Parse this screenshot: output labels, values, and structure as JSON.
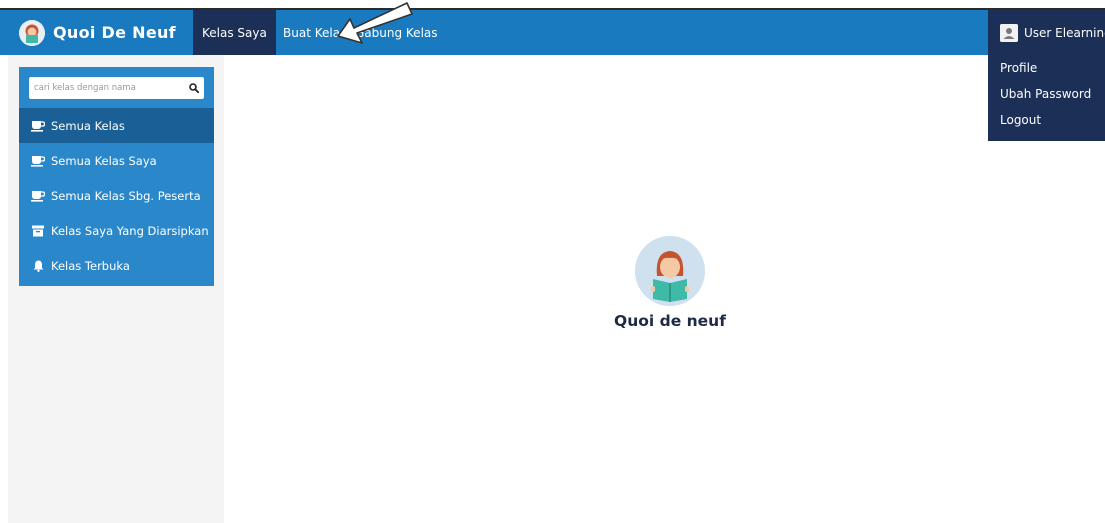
{
  "brand": {
    "name": "Quoi De Neuf"
  },
  "navbar": {
    "items": [
      {
        "label": "Kelas Saya",
        "active": true
      },
      {
        "label": "Buat Kelas",
        "active": false
      },
      {
        "label": "Gabung Kelas",
        "active": false
      }
    ]
  },
  "user_menu": {
    "name": "User Elearning",
    "items": [
      {
        "label": "Profile"
      },
      {
        "label": "Ubah Password"
      },
      {
        "label": "Logout"
      }
    ]
  },
  "sidebar": {
    "search": {
      "placeholder": "cari kelas dengan nama"
    },
    "items": [
      {
        "label": "Semua Kelas",
        "icon": "cup-icon",
        "active": true
      },
      {
        "label": "Semua Kelas Saya",
        "icon": "cup-icon",
        "active": false
      },
      {
        "label": "Semua Kelas Sbg. Peserta",
        "icon": "cup-icon",
        "active": false
      },
      {
        "label": "Kelas Saya Yang Diarsipkan",
        "icon": "archive-icon",
        "active": false
      },
      {
        "label": "Kelas Terbuka",
        "icon": "bell-icon",
        "active": false
      }
    ]
  },
  "main": {
    "empty_state": {
      "title": "Quoi de neuf",
      "illustration": "reading-girl-icon"
    }
  },
  "colors": {
    "navbar": "#1a7ac0",
    "navbar_active": "#1c2f57",
    "sidebar": "#2a87c9",
    "sidebar_active": "#1a5f95",
    "sidebar_bg": "#f4f4f4"
  }
}
